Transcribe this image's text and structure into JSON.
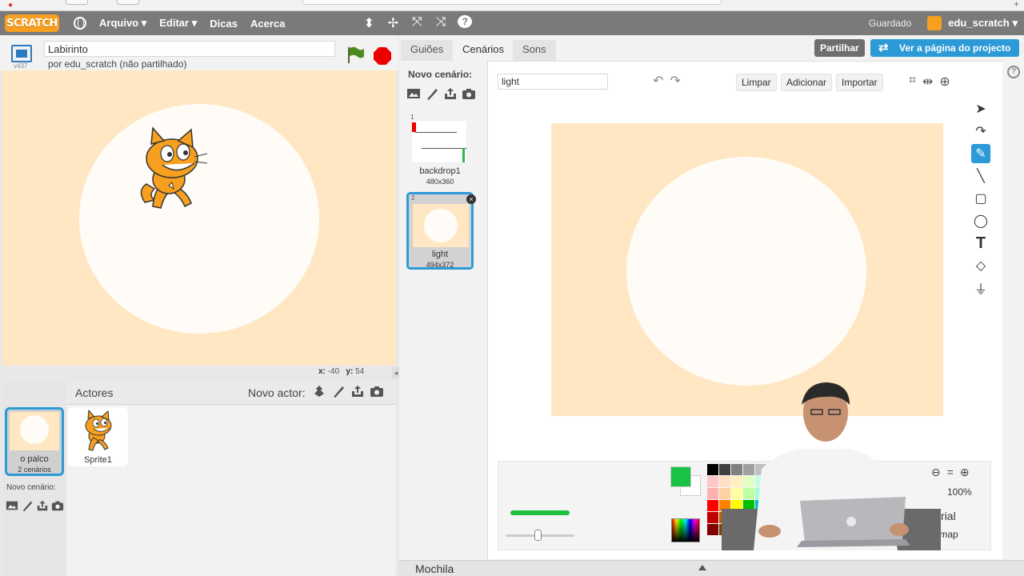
{
  "menubar": {
    "logo": "SCRATCH",
    "items": [
      "Arquivo ▾",
      "Editar ▾",
      "Dicas",
      "Acerca"
    ],
    "status": "Guardado",
    "user": "edu_scratch ▾"
  },
  "stage": {
    "version": "v437",
    "project_title": "Labirinto",
    "byline": "por edu_scratch (não partilhado)",
    "coords_x_label": "x:",
    "coords_x": "-40",
    "coords_y_label": "y:",
    "coords_y": "54"
  },
  "sprites": {
    "header": "Actores",
    "new_actor": "Novo actor:",
    "stage_label": "o palco",
    "stage_count": "2 cenários",
    "sprite_name": "Sprite1",
    "new_backdrop": "Novo cenário:"
  },
  "tabs": [
    "Guiões",
    "Cenários",
    "Sons"
  ],
  "header_buttons": {
    "share": "Partilhar",
    "project_page": "Ver a página do projecto"
  },
  "backdrops": {
    "new_label": "Novo cenário:",
    "items": [
      {
        "num": "1",
        "name": "backdrop1",
        "size": "480x360"
      },
      {
        "num": "2",
        "name": "light",
        "size": "494x372"
      }
    ]
  },
  "paint": {
    "name_value": "light",
    "buttons": [
      "Limpar",
      "Adicionar",
      "Importar"
    ],
    "zoom": "100%",
    "mode": "Vectorial",
    "convert": "ara bitmap",
    "primary_color": "#17c244"
  },
  "mochila": "Mochila"
}
